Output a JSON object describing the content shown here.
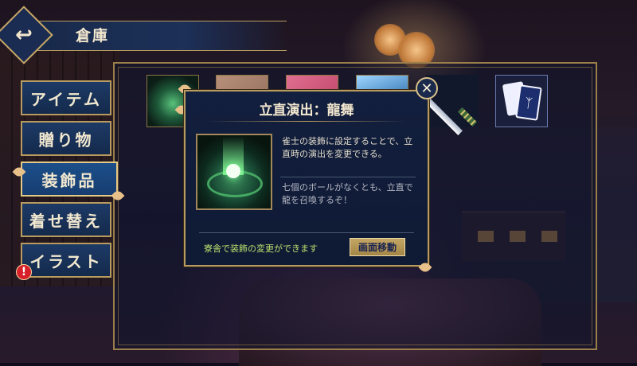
{
  "header": {
    "title": "倉庫",
    "back_icon": "↩"
  },
  "tabs": [
    {
      "label": "アイテム"
    },
    {
      "label": "贈り物"
    },
    {
      "label": "装飾品"
    },
    {
      "label": "着せ替え"
    },
    {
      "label": "イラスト"
    }
  ],
  "active_tab": "装飾品",
  "alert_badge": "!",
  "items": [
    "dragon-swirl-decoration",
    "sand-card",
    "pink-card",
    "blue-sky-card",
    "katana",
    "card-pair"
  ],
  "popup": {
    "title": "立直演出：龍舞",
    "close_icon": "✕",
    "desc_main": "雀士の装飾に設定することで、立直時の演出を変更できる。",
    "desc_flavor": "七個のボールがなくとも、立直で龍を召喚するぞ！",
    "footer_text": "寮舎で装飾の変更ができます",
    "button_label": "画面移動"
  },
  "colors": {
    "frame_gold": "#b89b5e",
    "panel_navy": "#121f3e",
    "tab_blue": "#1d3a66",
    "footer_green": "#b8e06c"
  }
}
